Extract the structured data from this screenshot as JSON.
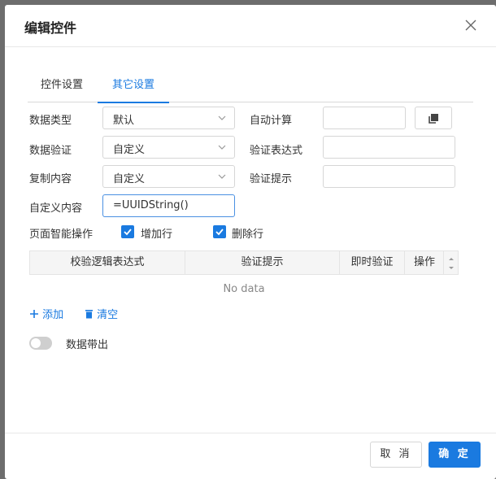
{
  "dialog": {
    "title": "编辑控件"
  },
  "tabs": [
    {
      "label": "控件设置"
    },
    {
      "label": "其它设置"
    }
  ],
  "form": {
    "data_type": {
      "label": "数据类型",
      "value": "默认"
    },
    "auto_calc": {
      "label": "自动计算",
      "value": ""
    },
    "data_validation": {
      "label": "数据验证",
      "value": "自定义"
    },
    "validation_expr": {
      "label": "验证表达式",
      "value": ""
    },
    "copy_content": {
      "label": "复制内容",
      "value": "自定义"
    },
    "validation_hint": {
      "label": "验证提示",
      "value": ""
    },
    "custom_content": {
      "label": "自定义内容",
      "value": "=UUIDString()"
    },
    "smart_ops": {
      "label": "页面智能操作",
      "add_row": "增加行",
      "delete_row": "删除行"
    }
  },
  "table": {
    "columns": [
      "校验逻辑表达式",
      "验证提示",
      "即时验证",
      "操作"
    ],
    "empty_text": "No data"
  },
  "actions": {
    "add": "添加",
    "clear": "清空"
  },
  "data_out": {
    "label": "数据带出",
    "enabled": false
  },
  "footer": {
    "cancel": "取 消",
    "ok": "确 定"
  },
  "colors": {
    "accent": "#1a7ae0",
    "overlay": "#6d6d6d"
  }
}
